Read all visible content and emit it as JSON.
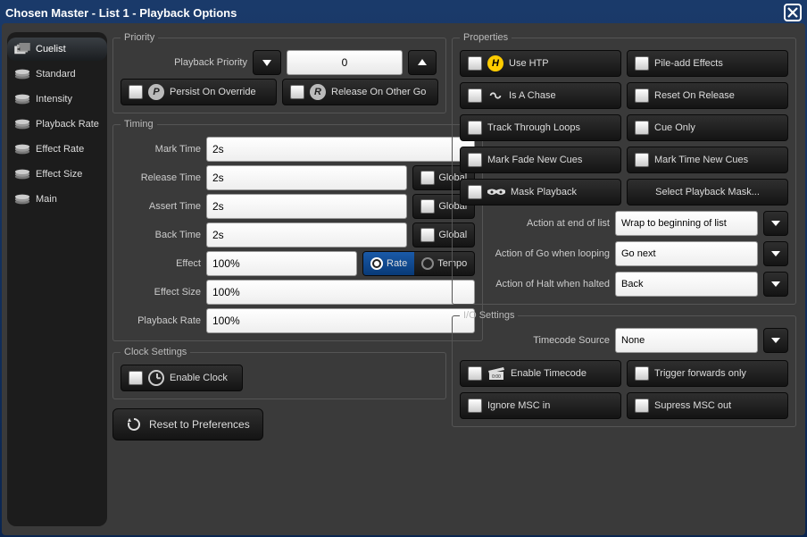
{
  "title": "Chosen Master - List 1 - Playback Options",
  "sidebar": {
    "items": [
      {
        "label": "Cuelist"
      },
      {
        "label": "Standard"
      },
      {
        "label": "Intensity"
      },
      {
        "label": "Playback Rate"
      },
      {
        "label": "Effect Rate"
      },
      {
        "label": "Effect Size"
      },
      {
        "label": "Main"
      }
    ]
  },
  "priority": {
    "legend": "Priority",
    "playback_priority_label": "Playback Priority",
    "playback_priority_value": "0",
    "persist_label": "Persist On Override",
    "release_other_label": "Release On Other Go"
  },
  "timing": {
    "legend": "Timing",
    "mark_time_label": "Mark Time",
    "mark_time_value": "2s",
    "release_time_label": "Release Time",
    "release_time_value": "2s",
    "assert_time_label": "Assert Time",
    "assert_time_value": "2s",
    "back_time_label": "Back Time",
    "back_time_value": "2s",
    "effect_label": "Effect",
    "effect_value": "100%",
    "rate_label": "Rate",
    "tempo_label": "Tempo",
    "effect_size_label": "Effect Size",
    "effect_size_value": "100%",
    "playback_rate_label": "Playback Rate",
    "playback_rate_value": "100%",
    "global_label": "Global"
  },
  "clock": {
    "legend": "Clock Settings",
    "enable_label": "Enable Clock"
  },
  "reset_label": "Reset to Preferences",
  "properties": {
    "legend": "Properties",
    "use_htp": "Use HTP",
    "pile_add": "Pile-add Effects",
    "is_chase": "Is A Chase",
    "reset_release": "Reset On Release",
    "track_loops": "Track Through Loops",
    "cue_only": "Cue Only",
    "mark_fade": "Mark Fade New Cues",
    "mark_time_new": "Mark Time New Cues",
    "mask_playback": "Mask Playback",
    "select_mask": "Select Playback Mask...",
    "action_end_label": "Action at end of list",
    "action_end_value": "Wrap to beginning of list",
    "action_go_loop_label": "Action of Go when looping",
    "action_go_loop_value": "Go next",
    "action_halt_label": "Action of Halt when halted",
    "action_halt_value": "Back"
  },
  "io": {
    "legend": "I/O Settings",
    "timecode_source_label": "Timecode Source",
    "timecode_source_value": "None",
    "enable_timecode": "Enable Timecode",
    "trigger_fwd": "Trigger forwards only",
    "ignore_msc": "Ignore MSC in",
    "supress_msc": "Supress MSC out"
  }
}
